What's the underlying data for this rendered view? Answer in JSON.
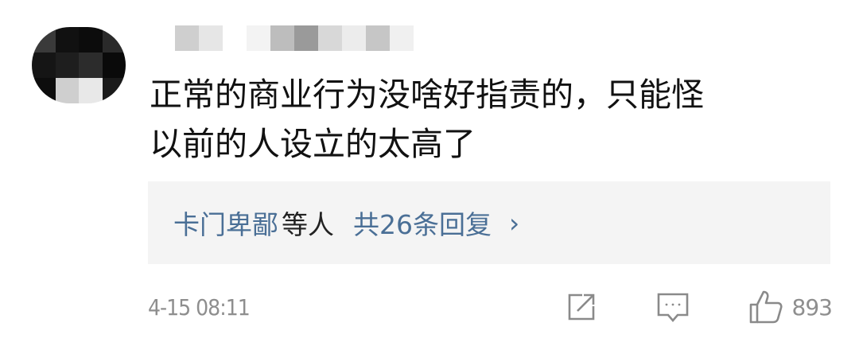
{
  "comment": {
    "avatar_icon": "pixelated-avatar",
    "username_icon": "pixelated-username",
    "text_line1": "正常的商业行为没啥好指责的，只能怪",
    "text_line2": "以前的人设立的太高了"
  },
  "replies": {
    "names": "卡门卑鄙",
    "names_suffix": "等人",
    "count_label": "共26条回复",
    "chevron": "›"
  },
  "footer": {
    "timestamp": "4-15 08:11",
    "share_icon": "share-icon",
    "comment_icon": "comment-icon",
    "like_icon": "thumbs-up-icon",
    "like_count": "893"
  },
  "colors": {
    "link": "#4a6f96",
    "muted": "#8e8e8e",
    "reply_bg": "#f4f4f4"
  }
}
